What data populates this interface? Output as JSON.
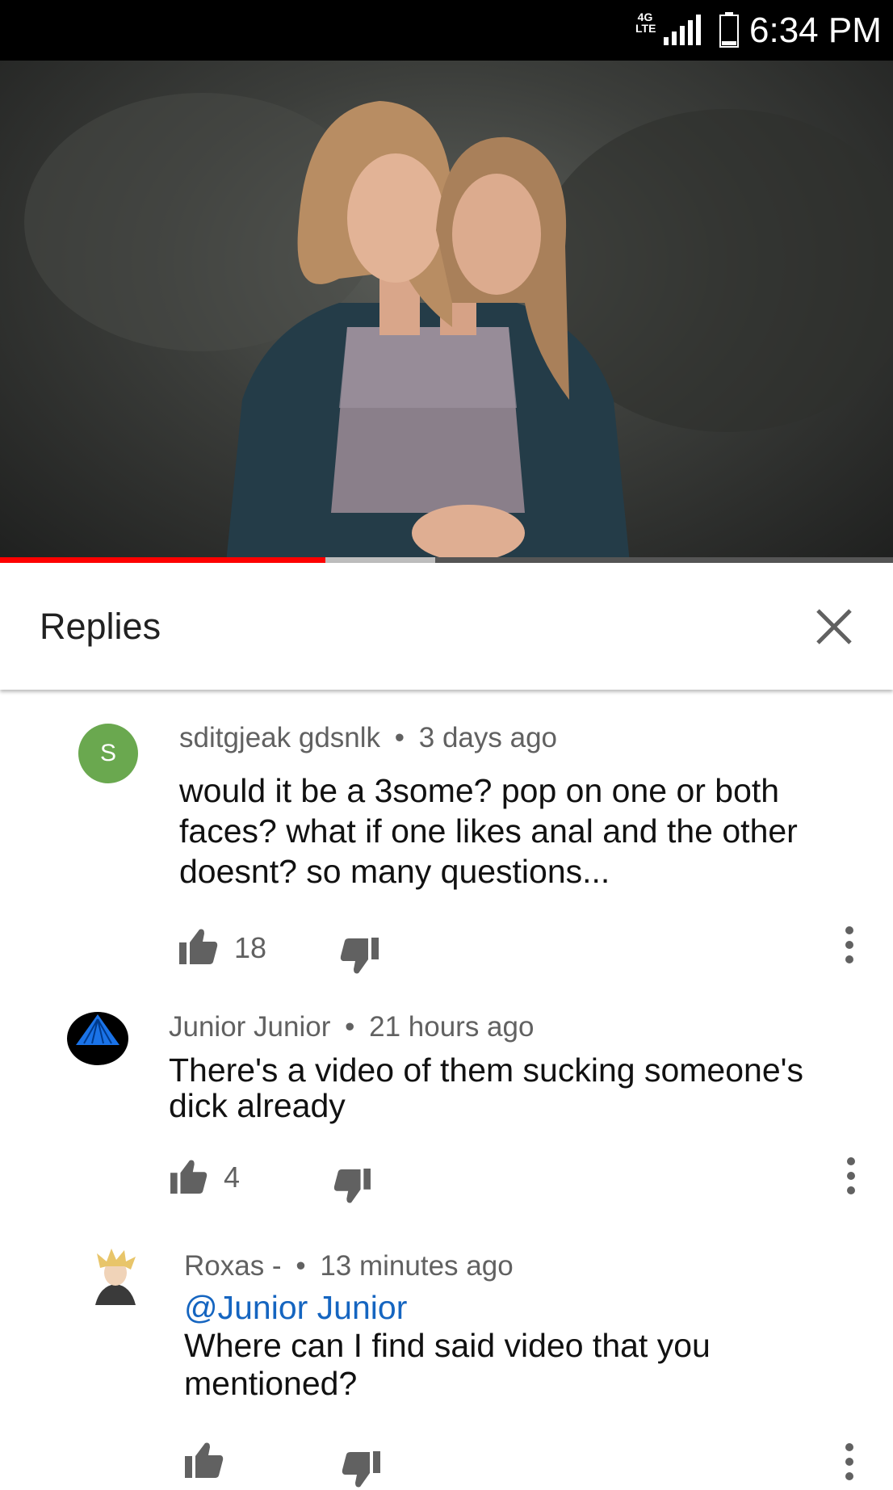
{
  "status_bar": {
    "network": "4G LTE",
    "time": "6:34 PM"
  },
  "video": {
    "progress_played_fraction": 0.364,
    "progress_buffered_fraction": 0.487
  },
  "panel": {
    "title": "Replies",
    "close_icon": "close-icon"
  },
  "comments": [
    {
      "author": "sditgjeak gdsnlk",
      "separator": "•",
      "time": "3 days ago",
      "avatar_letter": "S",
      "avatar_color": "#6aa84f",
      "body_lines": [
        "would it be a 3some? pop on one or both",
        "faces? what if one likes anal and the other",
        "doesnt? so many questions..."
      ],
      "likes": "18"
    },
    {
      "author": "Junior Junior",
      "separator": "•",
      "time": "21 hours ago",
      "body_lines": [
        "There's a video of them sucking someone's",
        "dick already"
      ],
      "likes": "4"
    },
    {
      "author": "Roxas -",
      "separator": "•",
      "time": "13 minutes ago",
      "mention": "@Junior Junior",
      "body_lines": [
        "Where can I find said video that you",
        "mentioned?"
      ],
      "likes": ""
    }
  ],
  "colors": {
    "accent_red": "#ff0000",
    "mention_blue": "#1565c0"
  }
}
